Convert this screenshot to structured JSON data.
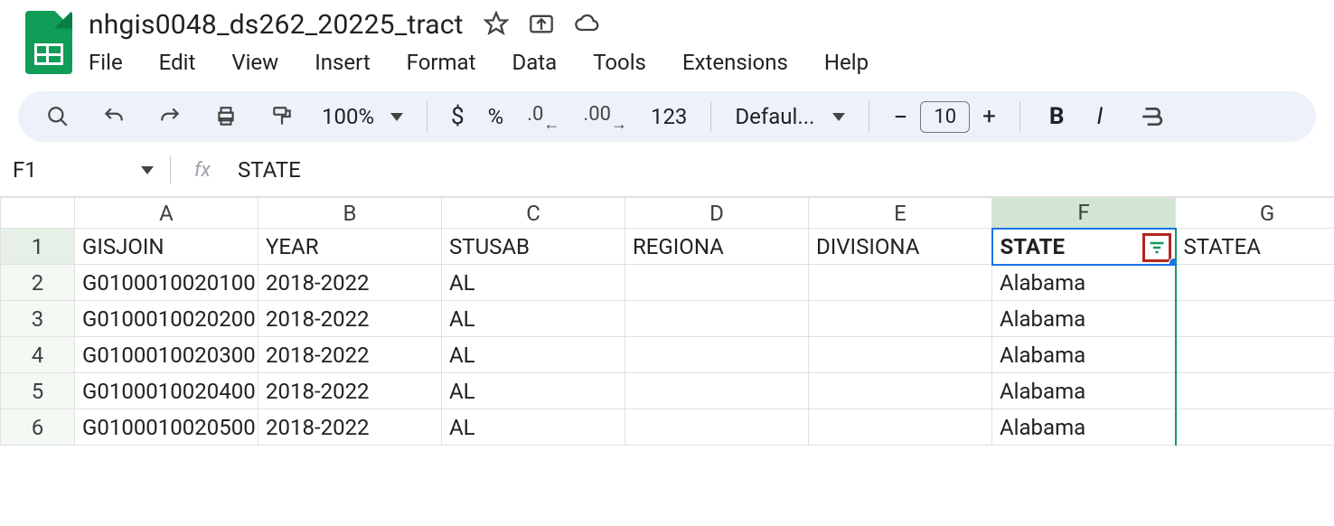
{
  "header": {
    "doc_title": "nhgis0048_ds262_20225_tract",
    "menus": [
      "File",
      "Edit",
      "View",
      "Insert",
      "Format",
      "Data",
      "Tools",
      "Extensions",
      "Help"
    ]
  },
  "toolbar": {
    "zoom": "100%",
    "currency": "$",
    "percent": "%",
    "dec_dec": ".0",
    "dec_inc": ".00",
    "num_fmt": "123",
    "font_name": "Defaul...",
    "font_size": "10",
    "minus": "−",
    "plus": "+",
    "bold": "B",
    "italic": "I",
    "strike": "S"
  },
  "fx": {
    "cell_ref": "F1",
    "formula_label": "fx",
    "value": "STATE"
  },
  "columns": [
    "A",
    "B",
    "C",
    "D",
    "E",
    "F",
    "G"
  ],
  "rows": [
    1,
    2,
    3,
    4,
    5,
    6
  ],
  "selected_column_index": 5,
  "data": {
    "1": [
      "GISJOIN",
      "YEAR",
      "STUSAB",
      "REGIONA",
      "DIVISIONA",
      "STATE",
      "STATEA"
    ],
    "2": [
      "G0100010020100",
      "2018-2022",
      "AL",
      "",
      "",
      "Alabama",
      ""
    ],
    "3": [
      "G0100010020200",
      "2018-2022",
      "AL",
      "",
      "",
      "Alabama",
      ""
    ],
    "4": [
      "G0100010020300",
      "2018-2022",
      "AL",
      "",
      "",
      "Alabama",
      ""
    ],
    "5": [
      "G0100010020400",
      "2018-2022",
      "AL",
      "",
      "",
      "Alabama",
      ""
    ],
    "6": [
      "G0100010020500",
      "2018-2022",
      "AL",
      "",
      "",
      "Alabama",
      ""
    ]
  }
}
